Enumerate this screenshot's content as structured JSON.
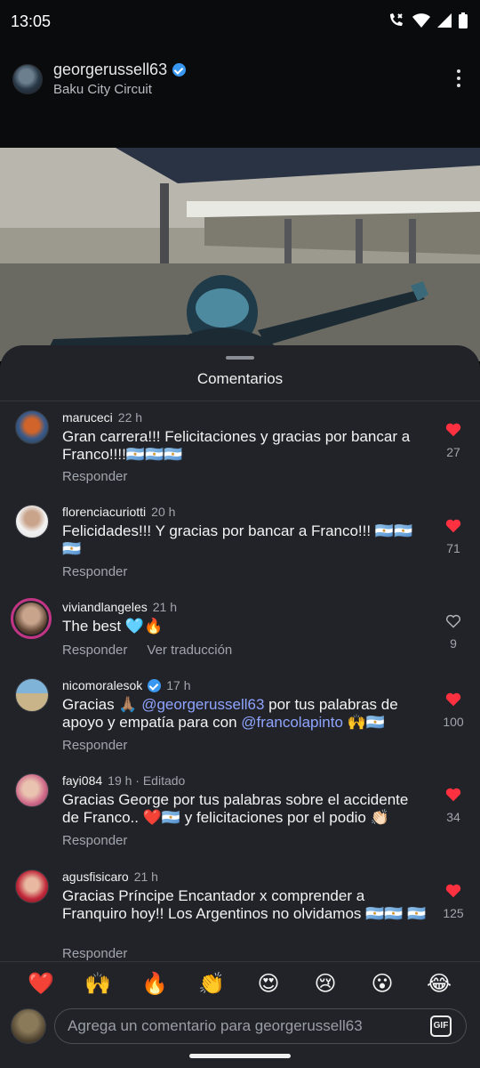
{
  "status_bar": {
    "time": "13:05"
  },
  "post": {
    "username": "georgerussell63",
    "location": "Baku City Circuit"
  },
  "sheet": {
    "title": "Comentarios"
  },
  "comments": [
    {
      "username": "maruceci",
      "time": "22 h",
      "text": "Gran carrera!!! Felicitaciones y gracias por bancar a Franco!!!!🇦🇷🇦🇷🇦🇷",
      "reply_label": "Responder",
      "likes": "27",
      "liked": true
    },
    {
      "username": "florenciacuriotti",
      "time": "20 h",
      "text": "Felicidades!!! Y gracias por bancar a Franco!!! 🇦🇷🇦🇷 🇦🇷",
      "reply_label": "Responder",
      "likes": "71",
      "liked": true
    },
    {
      "username": "viviandlangeles",
      "time": "21 h",
      "text": "The best 🩵🔥",
      "reply_label": "Responder",
      "translate_label": "Ver traducción",
      "likes": "9",
      "liked": false
    },
    {
      "username": "nicomoralesok",
      "time": "17 h",
      "text_before": "Gracias 🙏🏽 ",
      "mention1": "@georgerussell63",
      "text_middle": " por tus palabras de apoyo y empatía para con ",
      "mention2": "@francolapinto",
      "text_after": " 🙌🇦🇷",
      "reply_label": "Responder",
      "likes": "100",
      "liked": true
    },
    {
      "username": "fayi084",
      "time": "19 h · Editado",
      "text": "Gracias George por tus palabras sobre el accidente de Franco.. ❤️🇦🇷 y felicitaciones por el podio 👏🏻",
      "reply_label": "Responder",
      "likes": "34",
      "liked": true
    },
    {
      "username": "agusfisicaro",
      "time": "21 h",
      "text": "Gracias Príncipe Encantador x comprender a Franquiro hoy!! Los Argentinos no olvidamos 🇦🇷🇦🇷 🇦🇷",
      "reply_label": "Responder",
      "likes": "125",
      "liked": true
    }
  ],
  "emoji_bar": [
    "❤️",
    "🙌",
    "🔥",
    "👏",
    "😍",
    "😢",
    "😮",
    "😂"
  ],
  "composer": {
    "placeholder": "Agrega un comentario para georgerussell63",
    "gif_label": "GIF"
  },
  "colors": {
    "like_red": "#ff3040",
    "mention_blue": "#8fa4ff",
    "verified_blue": "#3897f0",
    "sheet_bg": "#212328"
  }
}
